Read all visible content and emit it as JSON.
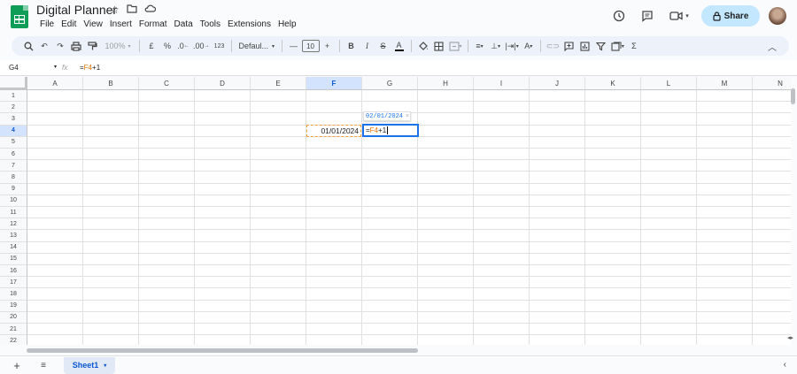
{
  "app": {
    "title": "Digital Planner"
  },
  "title_icons": [
    "star-icon",
    "folder-icon",
    "cloud-icon"
  ],
  "menu": [
    "File",
    "Edit",
    "View",
    "Insert",
    "Format",
    "Data",
    "Tools",
    "Extensions",
    "Help"
  ],
  "header_right": {
    "share_label": "Share"
  },
  "toolbar": {
    "zoom": "100%",
    "currency": "£",
    "percent": "%",
    "decrease_decimal": ".0",
    "increase_decimal": ".00",
    "number_format": "123",
    "font": "Defaul...",
    "font_size": "10",
    "bold": "B",
    "italic": "I",
    "text_color": "A",
    "sum": "Σ"
  },
  "formula_bar": {
    "name_box": "G4",
    "fx": "fx",
    "formula_prefix": "=",
    "formula_ref": "F4",
    "formula_suffix": "+1"
  },
  "grid": {
    "columns": [
      "A",
      "B",
      "C",
      "D",
      "E",
      "F",
      "G",
      "H",
      "I",
      "J",
      "K",
      "L",
      "M",
      "N"
    ],
    "selected_column": "F",
    "rows": [
      "1",
      "2",
      "3",
      "4",
      "5",
      "6",
      "7",
      "8",
      "9",
      "10",
      "11",
      "12",
      "13",
      "14",
      "15",
      "16",
      "17",
      "18",
      "19",
      "20",
      "21",
      "22"
    ],
    "selected_row": "4",
    "cells": {
      "F4": "01/01/2024",
      "G4_prefix": "=",
      "G4_ref": "F4",
      "G4_suffix": "+1"
    },
    "preview_value": "02/01/2024",
    "preview_close": "×"
  },
  "bottom": {
    "sheet_name": "Sheet1"
  },
  "colors": {
    "accent": "#1a73e8",
    "share_bg": "#c2e7ff",
    "sheets_green": "#0f9d58",
    "ref_orange": "#e37400"
  }
}
